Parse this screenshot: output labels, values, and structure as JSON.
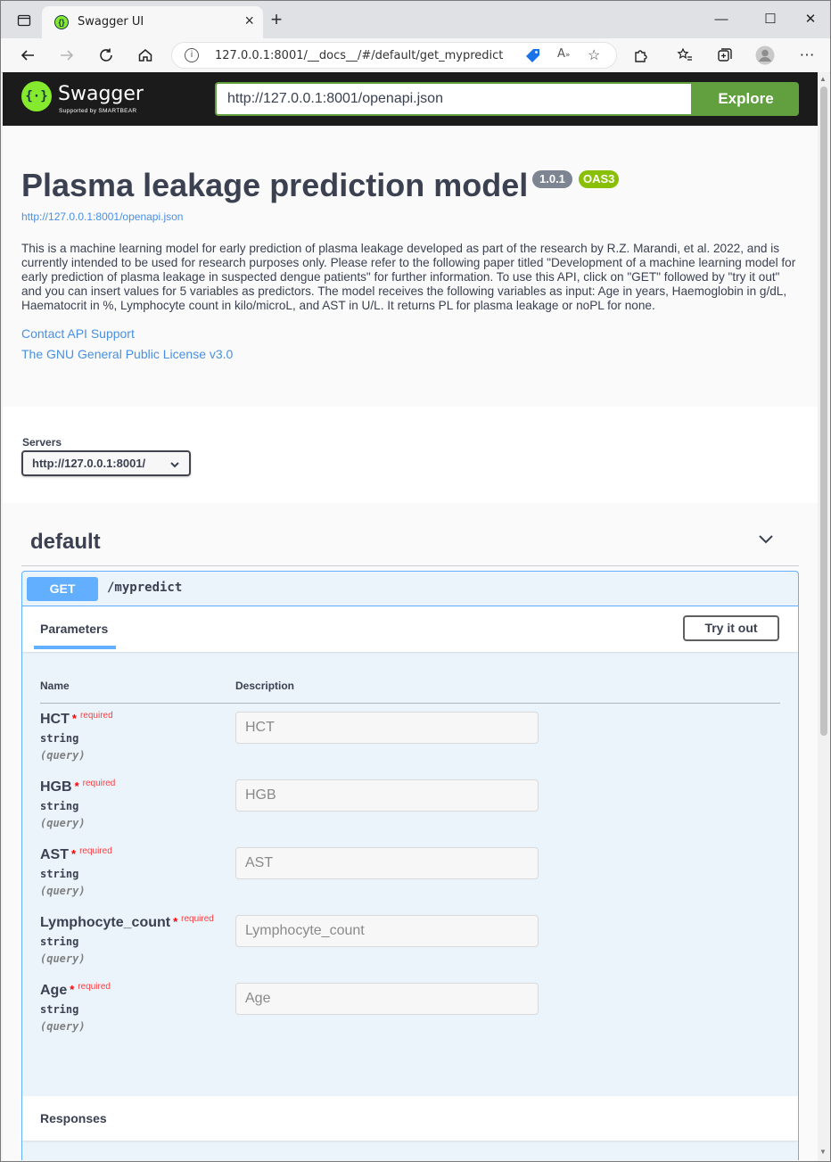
{
  "browser": {
    "tab_title": "Swagger UI",
    "url": "127.0.0.1:8001/__docs__/#/default/get_mypredict"
  },
  "swagger_bar": {
    "brand": "Swagger",
    "brand_sub": "Supported by SMARTBEAR",
    "spec_url": "http://127.0.0.1:8001/openapi.json",
    "explore_label": "Explore"
  },
  "info": {
    "title": "Plasma leakage prediction model",
    "version": "1.0.1",
    "oas": "OAS3",
    "spec_link": "http://127.0.0.1:8001/openapi.json",
    "description": "This is a machine learning model for early prediction of plasma leakage developed as part of the research by R.Z. Marandi, et al. 2022, and is currently intended to be used for research purposes only. Please refer to the following paper titled \"Development of a machine learning model for early prediction of plasma leakage in suspected dengue patients\" for further information. To use this API, click on \"GET\" followed by \"try it out\" and you can insert values for 5 variables as predictors. The model receives the following variables as input: Age in years, Haemoglobin in g/dL, Haematocrit in %, Lymphocyte count in kilo/microL, and AST in U/L. It returns PL for plasma leakage or noPL for none.",
    "contact": "Contact API Support",
    "license": "The GNU General Public License v3.0"
  },
  "servers": {
    "label": "Servers",
    "selected": "http://127.0.0.1:8001/"
  },
  "operations": {
    "tag": "default",
    "method": "GET",
    "path": "/mypredict",
    "parameters_tab": "Parameters",
    "try_it_out": "Try it out",
    "col_name": "Name",
    "col_description": "Description",
    "required_text": "required",
    "params": [
      {
        "name": "HCT",
        "type": "string",
        "in": "(query)",
        "placeholder": "HCT"
      },
      {
        "name": "HGB",
        "type": "string",
        "in": "(query)",
        "placeholder": "HGB"
      },
      {
        "name": "AST",
        "type": "string",
        "in": "(query)",
        "placeholder": "AST"
      },
      {
        "name": "Lymphocyte_count",
        "type": "string",
        "in": "(query)",
        "placeholder": "Lymphocyte_count"
      },
      {
        "name": "Age",
        "type": "string",
        "in": "(query)",
        "placeholder": "Age"
      }
    ],
    "responses": "Responses"
  },
  "colors": {
    "get_blue": "#61affe",
    "explore_green": "#62a03f",
    "oas_green": "#89bf04",
    "link_blue": "#4990e2",
    "text": "#3b4151"
  }
}
